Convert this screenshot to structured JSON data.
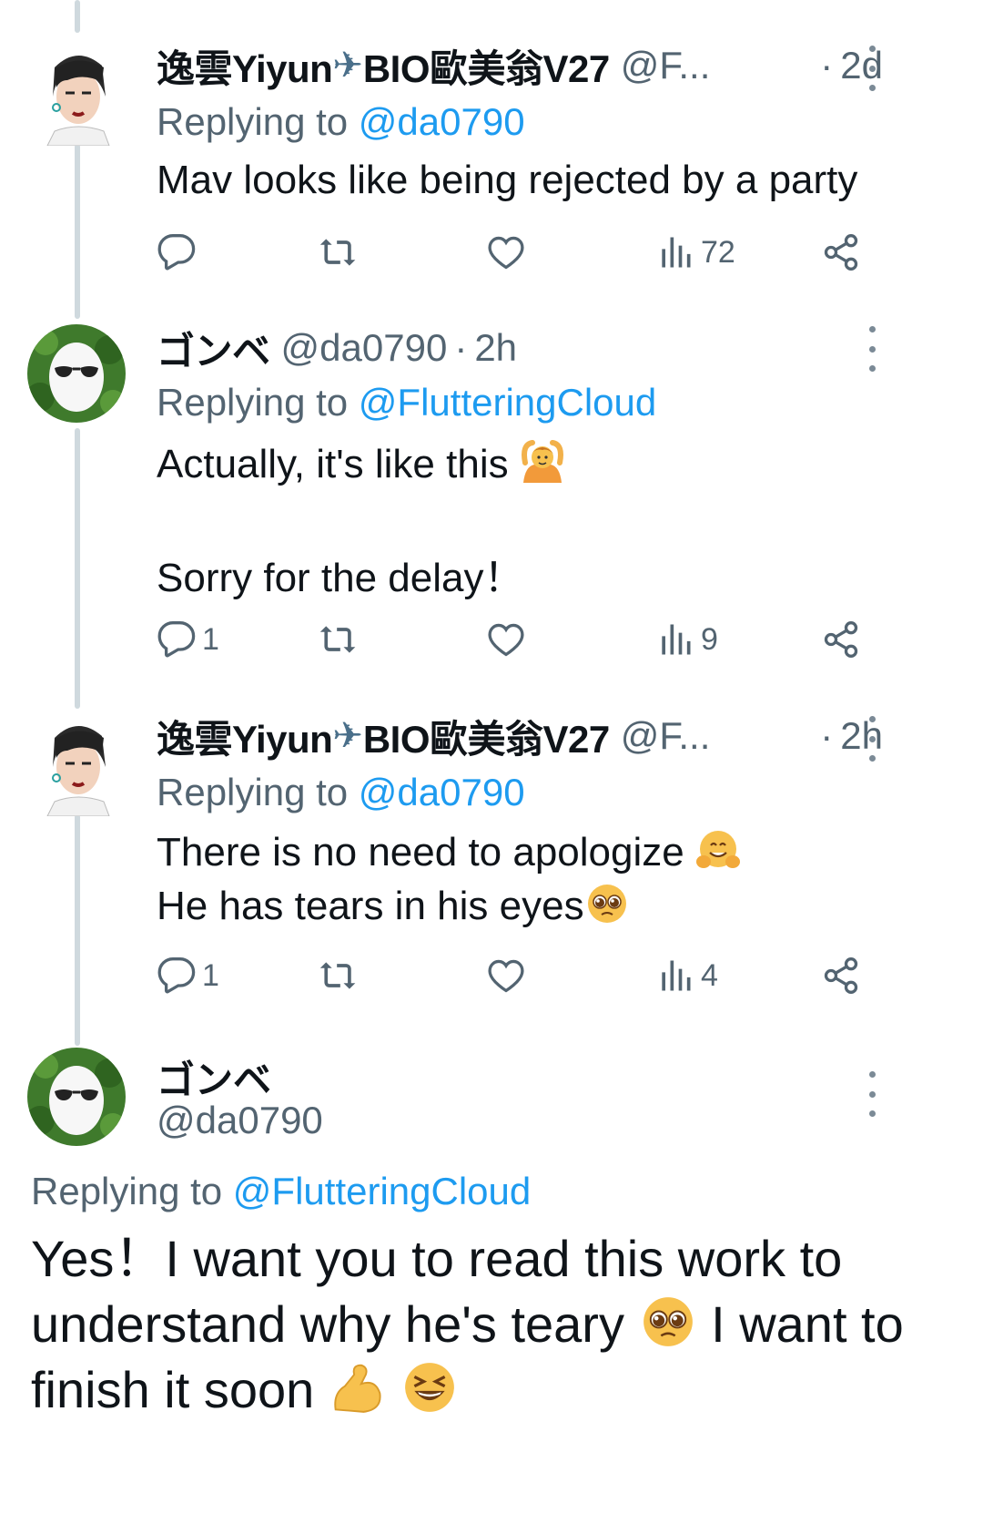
{
  "tweets": [
    {
      "display_name": "逸雲Yiyun",
      "plane": "✈",
      "display_name_2": "BIO歐美翁V27",
      "handle": "@F...",
      "time": "2d",
      "reply_prefix": "Replying to",
      "reply_to": "@da0790",
      "lines": [
        "Mav looks like being rejected by a party"
      ],
      "stats": {
        "replies": "",
        "reposts": "",
        "likes": "",
        "views": "72"
      }
    },
    {
      "display_name": "ゴンベ",
      "handle": "@da0790",
      "time": "2h",
      "reply_prefix": "Replying to",
      "reply_to": "@FlutteringCloud",
      "line1": "Actually, it's like this",
      "line1_emoji": "person-gesturing-ok-emoji",
      "line2": "Sorry for the delay！",
      "stats": {
        "replies": "1",
        "reposts": "",
        "likes": "",
        "views": "9"
      }
    },
    {
      "display_name": "逸雲Yiyun",
      "plane": "✈",
      "display_name_2": "BIO歐美翁V27",
      "handle": "@F...",
      "time": "2h",
      "reply_prefix": "Replying to",
      "reply_to": "@da0790",
      "line1": "There is no need to apologize",
      "line1_emoji": "hugging-face-emoji",
      "line2": "He has tears in his eyes",
      "line2_emoji": "pleading-face-emoji",
      "stats": {
        "replies": "1",
        "reposts": "",
        "likes": "",
        "views": "4"
      }
    }
  ],
  "main_tweet": {
    "display_name": "ゴンベ",
    "handle": "@da0790",
    "reply_prefix": "Replying to",
    "reply_to": "@FlutteringCloud",
    "text_line1": "Yes！I want you to read this work to",
    "text_line2a": "understand why he's teary",
    "text_line2b": "I want to",
    "text_line3": "finish it soon",
    "emojis": [
      "pleading-face-emoji",
      "flexed-biceps-emoji",
      "grinning-squinting-face-emoji"
    ]
  },
  "colors": {
    "link_blue": "#1d9bf0",
    "muted_gray": "#536471",
    "thread_line": "#cfd9de",
    "text": "#0f1419"
  },
  "icons": [
    "reply-icon",
    "repost-icon",
    "like-icon",
    "views-icon",
    "share-icon",
    "more-options-icon"
  ]
}
